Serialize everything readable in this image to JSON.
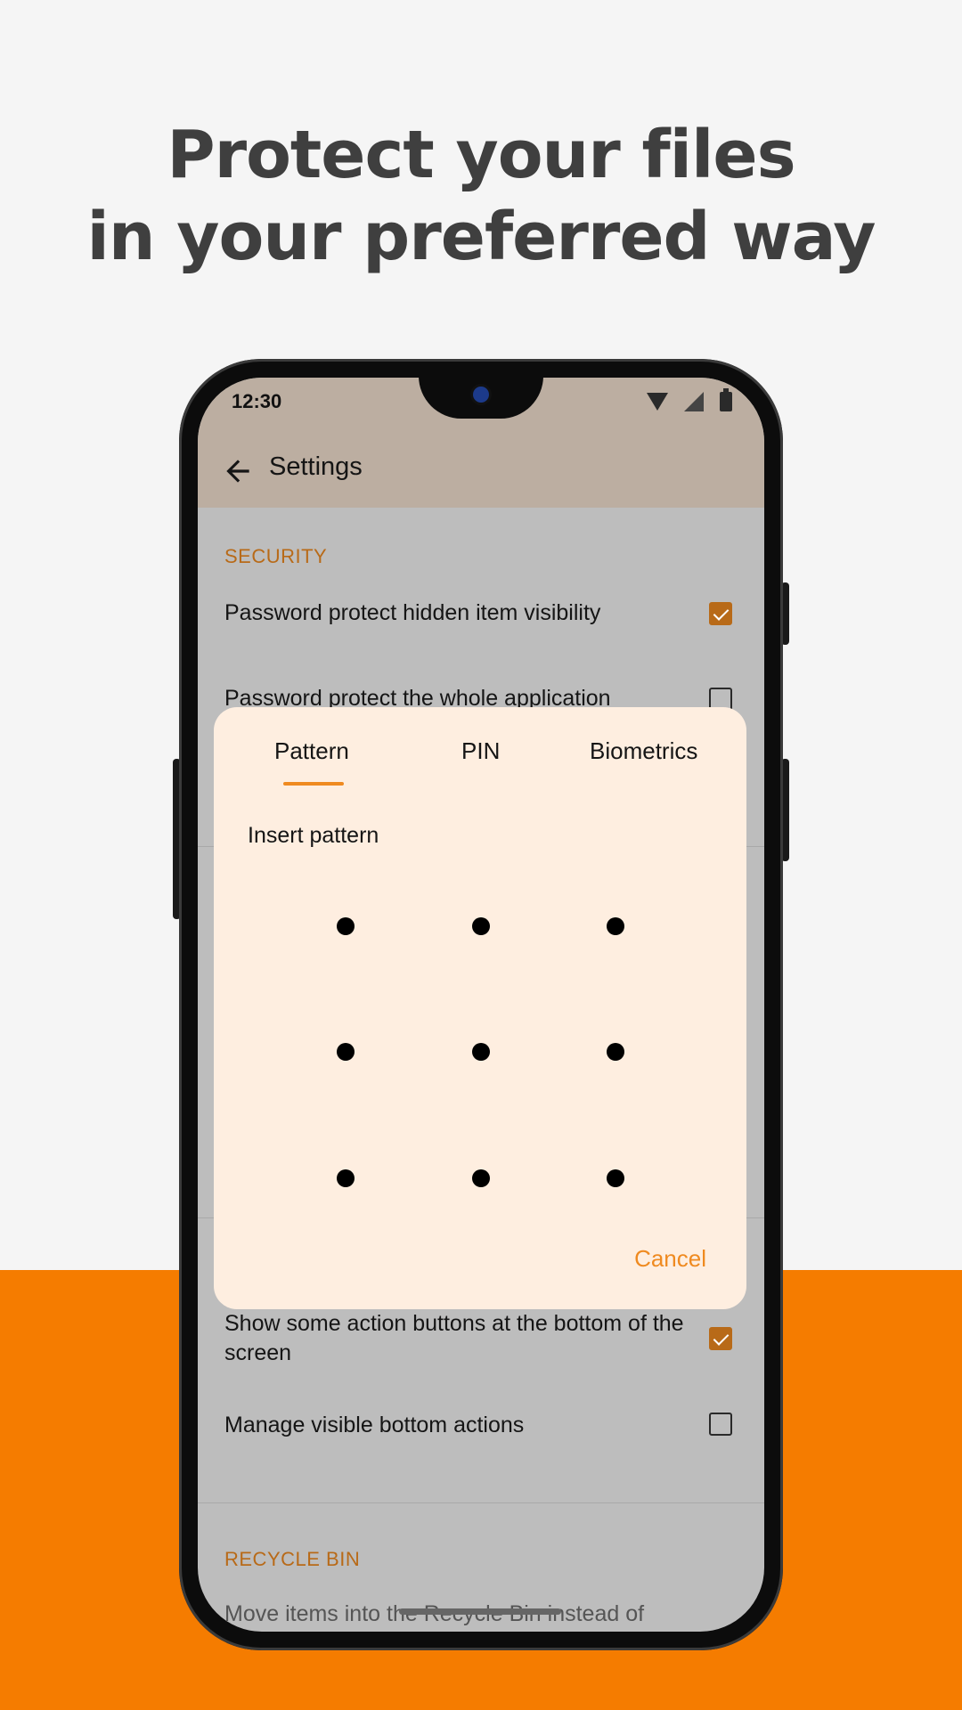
{
  "headline": {
    "line1": "Protect your files",
    "line2": "in your preferred way"
  },
  "status_bar": {
    "time": "12:30",
    "icons": [
      "wifi-icon",
      "signal-icon",
      "battery-icon"
    ]
  },
  "toolbar": {
    "back_icon": "arrow-left-icon",
    "title": "Settings"
  },
  "settings": {
    "security_header": "SECURITY",
    "hidden_item_visibility": {
      "label": "Password protect hidden item visibility",
      "checked": true
    },
    "whole_application": {
      "label": "Password protect the whole application",
      "checked": false
    },
    "bottom_action_buttons": {
      "label": "Show some action buttons at the bottom of the screen",
      "checked": true
    },
    "manage_bottom_actions": {
      "label": "Manage visible bottom actions",
      "checked": false
    },
    "recycle_bin_header": "RECYCLE BIN",
    "recycle_bin_move": {
      "label": "Move items into the Recycle Bin instead of"
    }
  },
  "dialog": {
    "tabs": [
      "Pattern",
      "PIN",
      "Biometrics"
    ],
    "selected_tab": "Pattern",
    "instruction": "Insert pattern",
    "pattern_grid": {
      "rows": 3,
      "cols": 3
    },
    "cancel_label": "Cancel"
  },
  "colors": {
    "accent": "#ef8a20",
    "section_header": "#b86a18",
    "bottom_band": "#f57c00",
    "toolbar": "#bcaea1",
    "dialog_bg": "#feeee0"
  }
}
